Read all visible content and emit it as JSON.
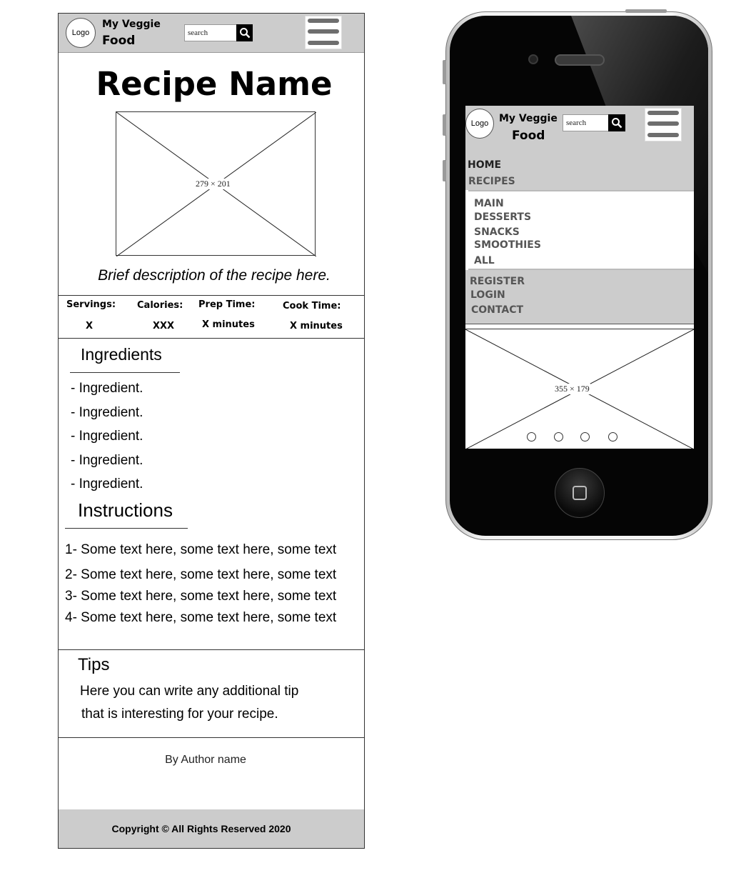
{
  "desktop": {
    "header": {
      "logo": "Logo",
      "brand_line1": "My Veggie",
      "brand_line2": "Food",
      "search_placeholder": "search"
    },
    "recipe_name": "Recipe Name",
    "image_label": "279 × 201",
    "description": "Brief description of the recipe here.",
    "stats": {
      "headers": [
        "Servings:",
        "Calories:",
        "Prep Time:",
        "Cook Time:"
      ],
      "values": [
        "X",
        "XXX",
        "X minutes",
        "X minutes"
      ]
    },
    "ingredients_title": "Ingredients",
    "ingredients": [
      "- Ingredient.",
      "- Ingredient.",
      "- Ingredient.",
      "- Ingredient.",
      "- Ingredient."
    ],
    "instructions_title": "Instructions",
    "instructions": [
      "1- Some text here, some text here, some text",
      "2- Some text here, some text here, some text",
      "3- Some text here, some text here, some text",
      "4- Some text here, some text here, some text"
    ],
    "tips": {
      "title": "Tips",
      "line1": "Here you can write any additional tip",
      "line2": "that is interesting for your recipe."
    },
    "author": "By Author name",
    "footer": "Copyright © All Rights Reserved 2020"
  },
  "mobile": {
    "header": {
      "logo": "Logo",
      "brand_line1": "My Veggie",
      "brand_line2": "Food",
      "search_placeholder": "search"
    },
    "nav": {
      "home": "HOME",
      "recipes": "RECIPES",
      "submenu": [
        "MAIN",
        "DESSERTS",
        "SNACKS",
        "SMOOTHIES",
        "ALL"
      ],
      "register": "REGISTER",
      "login": "LOGIN",
      "contact": "CONTACT"
    },
    "carousel_label": "355 × 179",
    "carousel_dots": 4
  },
  "colors": {
    "header_gray": "#cccccc",
    "phone_body": "#050505",
    "burger_bar": "#6e6e6e"
  }
}
